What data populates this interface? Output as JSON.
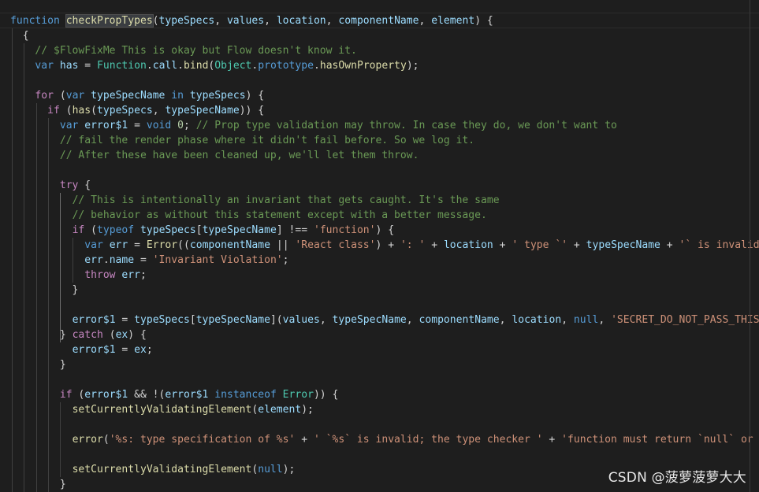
{
  "editor": {
    "colors": {
      "background": "#1e1e1e",
      "keyword": "#569cd6",
      "control": "#c586c0",
      "variable": "#9cdcfe",
      "function": "#dcdcaa",
      "type": "#4ec9b0",
      "string": "#ce9178",
      "comment": "#6a9955",
      "number": "#b5cea8",
      "text": "#d4d4d4"
    },
    "lines": [
      [
        {
          "t": "function",
          "c": "k"
        },
        {
          "t": " ",
          "c": "p"
        },
        {
          "t": "checkPropTypes",
          "c": "f",
          "h": true
        },
        {
          "t": "(",
          "c": "p"
        },
        {
          "t": "typeSpecs",
          "c": "v"
        },
        {
          "t": ", ",
          "c": "p"
        },
        {
          "t": "values",
          "c": "v"
        },
        {
          "t": ", ",
          "c": "p"
        },
        {
          "t": "location",
          "c": "v"
        },
        {
          "t": ", ",
          "c": "p"
        },
        {
          "t": "componentName",
          "c": "v"
        },
        {
          "t": ", ",
          "c": "p"
        },
        {
          "t": "element",
          "c": "v"
        },
        {
          "t": ") {",
          "c": "p"
        }
      ],
      [
        {
          "t": "  {",
          "c": "p"
        }
      ],
      [
        {
          "t": "    ",
          "c": "p"
        },
        {
          "t": "// $FlowFixMe This is okay but Flow doesn't know it.",
          "c": "m"
        }
      ],
      [
        {
          "t": "    ",
          "c": "p"
        },
        {
          "t": "var",
          "c": "k"
        },
        {
          "t": " ",
          "c": "p"
        },
        {
          "t": "has",
          "c": "v"
        },
        {
          "t": " = ",
          "c": "p"
        },
        {
          "t": "Function",
          "c": "t"
        },
        {
          "t": ".",
          "c": "p"
        },
        {
          "t": "call",
          "c": "v"
        },
        {
          "t": ".",
          "c": "p"
        },
        {
          "t": "bind",
          "c": "f"
        },
        {
          "t": "(",
          "c": "p"
        },
        {
          "t": "Object",
          "c": "t"
        },
        {
          "t": ".",
          "c": "p"
        },
        {
          "t": "prototype",
          "c": "k"
        },
        {
          "t": ".",
          "c": "p"
        },
        {
          "t": "hasOwnProperty",
          "c": "f"
        },
        {
          "t": ");",
          "c": "p"
        }
      ],
      [],
      [
        {
          "t": "    ",
          "c": "p"
        },
        {
          "t": "for",
          "c": "c"
        },
        {
          "t": " (",
          "c": "p"
        },
        {
          "t": "var",
          "c": "k"
        },
        {
          "t": " ",
          "c": "p"
        },
        {
          "t": "typeSpecName",
          "c": "v"
        },
        {
          "t": " ",
          "c": "p"
        },
        {
          "t": "in",
          "c": "k"
        },
        {
          "t": " ",
          "c": "p"
        },
        {
          "t": "typeSpecs",
          "c": "v"
        },
        {
          "t": ") {",
          "c": "p"
        }
      ],
      [
        {
          "t": "      ",
          "c": "p"
        },
        {
          "t": "if",
          "c": "c"
        },
        {
          "t": " (",
          "c": "p"
        },
        {
          "t": "has",
          "c": "f"
        },
        {
          "t": "(",
          "c": "p"
        },
        {
          "t": "typeSpecs",
          "c": "v"
        },
        {
          "t": ", ",
          "c": "p"
        },
        {
          "t": "typeSpecName",
          "c": "v"
        },
        {
          "t": ")) {",
          "c": "p"
        }
      ],
      [
        {
          "t": "        ",
          "c": "p"
        },
        {
          "t": "var",
          "c": "k"
        },
        {
          "t": " ",
          "c": "p"
        },
        {
          "t": "error$1",
          "c": "v"
        },
        {
          "t": " = ",
          "c": "p"
        },
        {
          "t": "void",
          "c": "k"
        },
        {
          "t": " ",
          "c": "p"
        },
        {
          "t": "0",
          "c": "n"
        },
        {
          "t": "; ",
          "c": "p"
        },
        {
          "t": "// Prop type validation may throw. In case they do, we don't want to",
          "c": "m"
        }
      ],
      [
        {
          "t": "        ",
          "c": "p"
        },
        {
          "t": "// fail the render phase where it didn't fail before. So we log it.",
          "c": "m"
        }
      ],
      [
        {
          "t": "        ",
          "c": "p"
        },
        {
          "t": "// After these have been cleaned up, we'll let them throw.",
          "c": "m"
        }
      ],
      [],
      [
        {
          "t": "        ",
          "c": "p"
        },
        {
          "t": "try",
          "c": "c"
        },
        {
          "t": " {",
          "c": "p"
        }
      ],
      [
        {
          "t": "          ",
          "c": "p"
        },
        {
          "t": "// This is intentionally an invariant that gets caught. It's the same",
          "c": "m"
        }
      ],
      [
        {
          "t": "          ",
          "c": "p"
        },
        {
          "t": "// behavior as without this statement except with a better message.",
          "c": "m"
        }
      ],
      [
        {
          "t": "          ",
          "c": "p"
        },
        {
          "t": "if",
          "c": "c"
        },
        {
          "t": " (",
          "c": "p"
        },
        {
          "t": "typeof",
          "c": "k"
        },
        {
          "t": " ",
          "c": "p"
        },
        {
          "t": "typeSpecs",
          "c": "v"
        },
        {
          "t": "[",
          "c": "p"
        },
        {
          "t": "typeSpecName",
          "c": "v"
        },
        {
          "t": "] !== ",
          "c": "p"
        },
        {
          "t": "'function'",
          "c": "s"
        },
        {
          "t": ") {",
          "c": "p"
        }
      ],
      [
        {
          "t": "            ",
          "c": "p"
        },
        {
          "t": "var",
          "c": "k"
        },
        {
          "t": " ",
          "c": "p"
        },
        {
          "t": "err",
          "c": "v"
        },
        {
          "t": " = ",
          "c": "p"
        },
        {
          "t": "Error",
          "c": "f"
        },
        {
          "t": "((",
          "c": "p"
        },
        {
          "t": "componentName",
          "c": "v"
        },
        {
          "t": " || ",
          "c": "p"
        },
        {
          "t": "'React class'",
          "c": "s"
        },
        {
          "t": ") + ",
          "c": "p"
        },
        {
          "t": "': '",
          "c": "s"
        },
        {
          "t": " + ",
          "c": "p"
        },
        {
          "t": "location",
          "c": "v"
        },
        {
          "t": " + ",
          "c": "p"
        },
        {
          "t": "' type `'",
          "c": "s"
        },
        {
          "t": " + ",
          "c": "p"
        },
        {
          "t": "typeSpecName",
          "c": "v"
        },
        {
          "t": " + ",
          "c": "p"
        },
        {
          "t": "'` is invalid;",
          "c": "s"
        }
      ],
      [
        {
          "t": "            ",
          "c": "p"
        },
        {
          "t": "err",
          "c": "v"
        },
        {
          "t": ".",
          "c": "p"
        },
        {
          "t": "name",
          "c": "v"
        },
        {
          "t": " = ",
          "c": "p"
        },
        {
          "t": "'Invariant Violation'",
          "c": "s"
        },
        {
          "t": ";",
          "c": "p"
        }
      ],
      [
        {
          "t": "            ",
          "c": "p"
        },
        {
          "t": "throw",
          "c": "c"
        },
        {
          "t": " ",
          "c": "p"
        },
        {
          "t": "err",
          "c": "v"
        },
        {
          "t": ";",
          "c": "p"
        }
      ],
      [
        {
          "t": "          }",
          "c": "p"
        }
      ],
      [],
      [
        {
          "t": "          ",
          "c": "p"
        },
        {
          "t": "error$1",
          "c": "v"
        },
        {
          "t": " = ",
          "c": "p"
        },
        {
          "t": "typeSpecs",
          "c": "v"
        },
        {
          "t": "[",
          "c": "p"
        },
        {
          "t": "typeSpecName",
          "c": "v"
        },
        {
          "t": "](",
          "c": "p"
        },
        {
          "t": "values",
          "c": "v"
        },
        {
          "t": ", ",
          "c": "p"
        },
        {
          "t": "typeSpecName",
          "c": "v"
        },
        {
          "t": ", ",
          "c": "p"
        },
        {
          "t": "componentName",
          "c": "v"
        },
        {
          "t": ", ",
          "c": "p"
        },
        {
          "t": "location",
          "c": "v"
        },
        {
          "t": ", ",
          "c": "p"
        },
        {
          "t": "null",
          "c": "k"
        },
        {
          "t": ", ",
          "c": "p"
        },
        {
          "t": "'SECRET_DO_NOT_PASS_THIS_",
          "c": "s"
        }
      ],
      [
        {
          "t": "        } ",
          "c": "p"
        },
        {
          "t": "catch",
          "c": "c"
        },
        {
          "t": " (",
          "c": "p"
        },
        {
          "t": "ex",
          "c": "v"
        },
        {
          "t": ") {",
          "c": "p"
        }
      ],
      [
        {
          "t": "          ",
          "c": "p"
        },
        {
          "t": "error$1",
          "c": "v"
        },
        {
          "t": " = ",
          "c": "p"
        },
        {
          "t": "ex",
          "c": "v"
        },
        {
          "t": ";",
          "c": "p"
        }
      ],
      [
        {
          "t": "        }",
          "c": "p"
        }
      ],
      [],
      [
        {
          "t": "        ",
          "c": "p"
        },
        {
          "t": "if",
          "c": "c"
        },
        {
          "t": " (",
          "c": "p"
        },
        {
          "t": "error$1",
          "c": "v"
        },
        {
          "t": " && !(",
          "c": "p"
        },
        {
          "t": "error$1",
          "c": "v"
        },
        {
          "t": " ",
          "c": "p"
        },
        {
          "t": "instanceof",
          "c": "k"
        },
        {
          "t": " ",
          "c": "p"
        },
        {
          "t": "Error",
          "c": "t"
        },
        {
          "t": ")) {",
          "c": "p"
        }
      ],
      [
        {
          "t": "          ",
          "c": "p"
        },
        {
          "t": "setCurrentlyValidatingElement",
          "c": "f"
        },
        {
          "t": "(",
          "c": "p"
        },
        {
          "t": "element",
          "c": "v"
        },
        {
          "t": ");",
          "c": "p"
        }
      ],
      [],
      [
        {
          "t": "          ",
          "c": "p"
        },
        {
          "t": "error",
          "c": "f"
        },
        {
          "t": "(",
          "c": "p"
        },
        {
          "t": "'%s: type specification of %s'",
          "c": "s"
        },
        {
          "t": " + ",
          "c": "p"
        },
        {
          "t": "' `%s` is invalid; the type checker '",
          "c": "s"
        },
        {
          "t": " + ",
          "c": "p"
        },
        {
          "t": "'function must return `null` or a",
          "c": "s"
        }
      ],
      [],
      [
        {
          "t": "          ",
          "c": "p"
        },
        {
          "t": "setCurrentlyValidatingElement",
          "c": "f"
        },
        {
          "t": "(",
          "c": "p"
        },
        {
          "t": "null",
          "c": "k"
        },
        {
          "t": ");",
          "c": "p"
        }
      ],
      [
        {
          "t": "        }",
          "c": "p"
        }
      ]
    ]
  },
  "watermark": {
    "text": "CSDN @菠萝菠萝大大"
  }
}
